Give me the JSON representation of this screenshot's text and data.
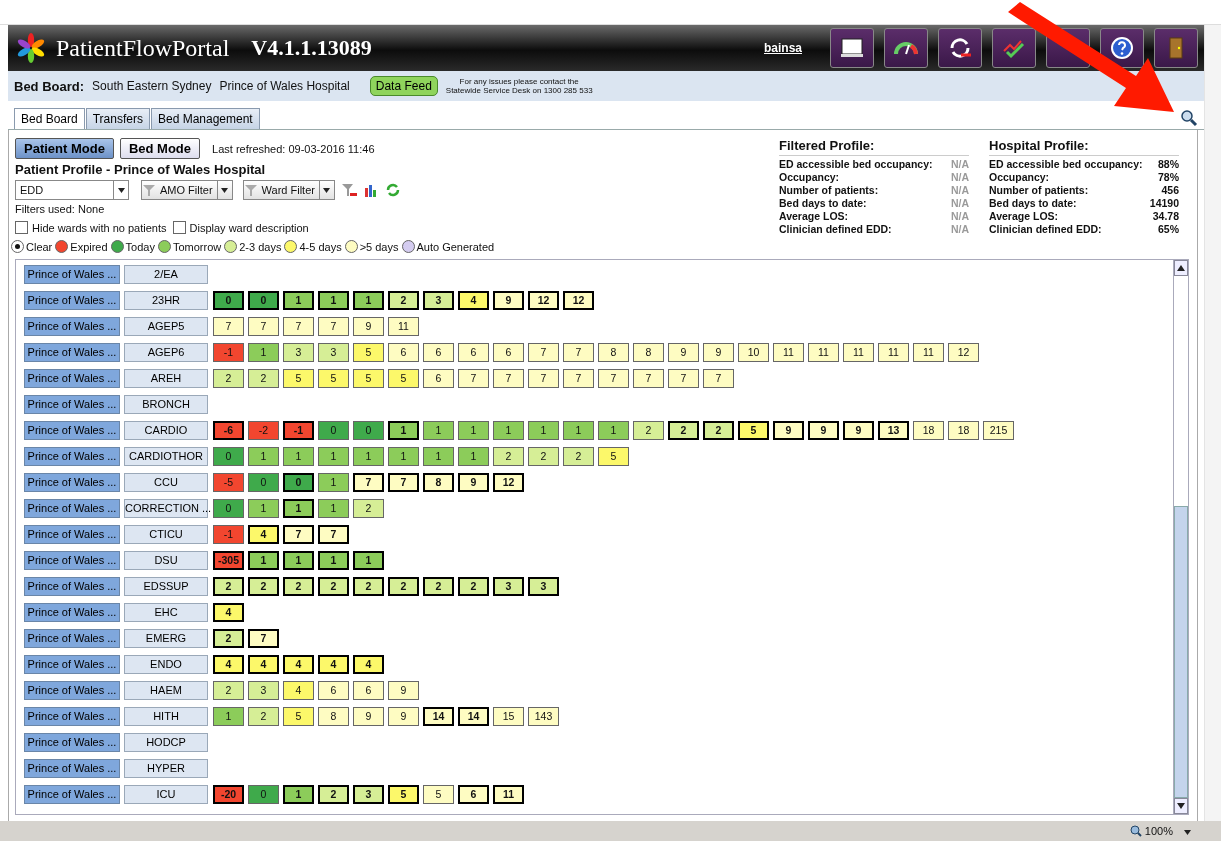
{
  "header": {
    "app_name": "PatientFlowPortal",
    "version": "V4.1.1.13089",
    "user": "bainsa"
  },
  "subheader": {
    "label": "Bed Board:",
    "area": "South Eastern Sydney",
    "hospital": "Prince of Wales Hospital",
    "feed_button": "Data Feed",
    "contact": [
      "For any issues please contact the",
      "Statewide Service Desk on 1300 285 533"
    ]
  },
  "tabs": [
    {
      "label": "Bed Board",
      "selected": true
    },
    {
      "label": "Transfers",
      "selected": false
    },
    {
      "label": "Bed Management",
      "selected": false
    }
  ],
  "modes": [
    {
      "label": "Patient Mode",
      "selected": true
    },
    {
      "label": "Bed Mode",
      "selected": false
    }
  ],
  "last_refreshed": "Last refreshed: 09-03-2016 11:46",
  "profile_title": "Patient Profile - Prince of Wales Hospital",
  "filters": {
    "sort": "EDD",
    "amo": "AMO Filter",
    "ward": "Ward Filter",
    "used": "Filters used: None"
  },
  "options": [
    {
      "label": "Hide wards with no patients",
      "checked": false
    },
    {
      "label": "Display ward description",
      "checked": false
    }
  ],
  "legend": [
    {
      "label": "Clear",
      "color": "#ffffff",
      "selected": true
    },
    {
      "label": "Expired",
      "color": "#f2462f",
      "selected": false
    },
    {
      "label": "Today",
      "color": "#3faa4b",
      "selected": false
    },
    {
      "label": "Tomorrow",
      "color": "#8ccc5a",
      "selected": false
    },
    {
      "label": "2-3 days",
      "color": "#d6ee96",
      "selected": false
    },
    {
      "label": "4-5 days",
      "color": "#fcf86a",
      "selected": false
    },
    {
      "label": ">5 days",
      "color": "#fefcc2",
      "selected": false
    },
    {
      "label": "Auto Generated",
      "color": "#d4ccf0",
      "selected": false
    }
  ],
  "profiles": [
    {
      "title": "Filtered Profile:",
      "muted": true,
      "rows": [
        [
          "ED accessible bed occupancy:",
          "N/A"
        ],
        [
          "Occupancy:",
          "N/A"
        ],
        [
          "Number of patients:",
          "N/A"
        ],
        [
          "Bed days to date:",
          "N/A"
        ],
        [
          "Average LOS:",
          "N/A"
        ],
        [
          "Clinician defined EDD:",
          "N/A"
        ]
      ]
    },
    {
      "title": "Hospital Profile:",
      "muted": false,
      "rows": [
        [
          "ED accessible bed occupancy:",
          "88%"
        ],
        [
          "Occupancy:",
          "78%"
        ],
        [
          "Number of patients:",
          "456"
        ],
        [
          "Bed days to date:",
          "14190"
        ],
        [
          "Average LOS:",
          "34.78"
        ],
        [
          "Clinician defined EDD:",
          "65%"
        ]
      ]
    }
  ],
  "wards": [
    {
      "hospital": "Prince of Wales ...",
      "ward": "2/EA"
    },
    {
      "hospital": "Prince of Wales ...",
      "ward": "23HR",
      "beds": [
        {
          "value": "0",
          "color": "#3faa4b",
          "bold": true
        },
        {
          "value": "0",
          "color": "#3faa4b",
          "bold": true
        },
        {
          "value": "1",
          "color": "#8ccc5a",
          "bold": true
        },
        {
          "value": "1",
          "color": "#8ccc5a",
          "bold": true
        },
        {
          "value": "1",
          "color": "#8ccc5a",
          "bold": true
        },
        {
          "value": "2",
          "color": "#d6ee96",
          "bold": true
        },
        {
          "value": "3",
          "color": "#d6ee96",
          "bold": true
        },
        {
          "value": "4",
          "color": "#fcf86a",
          "bold": true
        },
        {
          "value": "9",
          "color": "#fefcc2",
          "bold": true
        },
        {
          "value": "12",
          "color": "#fefcc2",
          "bold": true
        },
        {
          "value": "12",
          "color": "#fefcc2",
          "bold": true
        }
      ]
    },
    {
      "hospital": "Prince of Wales ...",
      "ward": "AGEP5",
      "beds": [
        {
          "value": "7",
          "color": "#fefcc2",
          "bold": false
        },
        {
          "value": "7",
          "color": "#fefcc2",
          "bold": false
        },
        {
          "value": "7",
          "color": "#fefcc2",
          "bold": false
        },
        {
          "value": "7",
          "color": "#fefcc2",
          "bold": false
        },
        {
          "value": "9",
          "color": "#fefcc2",
          "bold": false
        },
        {
          "value": "11",
          "color": "#fefcc2",
          "bold": false
        }
      ]
    },
    {
      "hospital": "Prince of Wales ...",
      "ward": "AGEP6",
      "beds": [
        {
          "value": "-1",
          "color": "#f2462f",
          "bold": false
        },
        {
          "value": "1",
          "color": "#8ccc5a",
          "bold": false
        },
        {
          "value": "3",
          "color": "#d6ee96",
          "bold": false
        },
        {
          "value": "3",
          "color": "#d6ee96",
          "bold": false
        },
        {
          "value": "5",
          "color": "#fcf86a",
          "bold": false
        },
        {
          "value": "6",
          "color": "#fefcc2",
          "bold": false
        },
        {
          "value": "6",
          "color": "#fefcc2",
          "bold": false
        },
        {
          "value": "6",
          "color": "#fefcc2",
          "bold": false
        },
        {
          "value": "6",
          "color": "#fefcc2",
          "bold": false
        },
        {
          "value": "7",
          "color": "#fefcc2",
          "bold": false
        },
        {
          "value": "7",
          "color": "#fefcc2",
          "bold": false
        },
        {
          "value": "8",
          "color": "#fefcc2",
          "bold": false
        },
        {
          "value": "8",
          "color": "#fefcc2",
          "bold": false
        },
        {
          "value": "9",
          "color": "#fefcc2",
          "bold": false
        },
        {
          "value": "9",
          "color": "#fefcc2",
          "bold": false
        },
        {
          "value": "10",
          "color": "#fefcc2",
          "bold": false
        },
        {
          "value": "11",
          "color": "#fefcc2",
          "bold": false
        },
        {
          "value": "11",
          "color": "#fefcc2",
          "bold": false
        },
        {
          "value": "11",
          "color": "#fefcc2",
          "bold": false
        },
        {
          "value": "11",
          "color": "#fefcc2",
          "bold": false
        },
        {
          "value": "11",
          "color": "#fefcc2",
          "bold": false
        },
        {
          "value": "12",
          "color": "#fefcc2",
          "bold": false
        }
      ]
    },
    {
      "hospital": "Prince of Wales ...",
      "ward": "AREH",
      "beds": [
        {
          "value": "2",
          "color": "#d6ee96",
          "bold": false
        },
        {
          "value": "2",
          "color": "#d6ee96",
          "bold": false
        },
        {
          "value": "5",
          "color": "#fcf86a",
          "bold": false
        },
        {
          "value": "5",
          "color": "#fcf86a",
          "bold": false
        },
        {
          "value": "5",
          "color": "#fcf86a",
          "bold": false
        },
        {
          "value": "5",
          "color": "#fcf86a",
          "bold": false
        },
        {
          "value": "6",
          "color": "#fefcc2",
          "bold": false
        },
        {
          "value": "7",
          "color": "#fefcc2",
          "bold": false
        },
        {
          "value": "7",
          "color": "#fefcc2",
          "bold": false
        },
        {
          "value": "7",
          "color": "#fefcc2",
          "bold": false
        },
        {
          "value": "7",
          "color": "#fefcc2",
          "bold": false
        },
        {
          "value": "7",
          "color": "#fefcc2",
          "bold": false
        },
        {
          "value": "7",
          "color": "#fefcc2",
          "bold": false
        },
        {
          "value": "7",
          "color": "#fefcc2",
          "bold": false
        },
        {
          "value": "7",
          "color": "#fefcc2",
          "bold": false
        }
      ]
    },
    {
      "hospital": "Prince of Wales ...",
      "ward": "BRONCH"
    },
    {
      "hospital": "Prince of Wales ...",
      "ward": "CARDIO",
      "beds": [
        {
          "value": "-6",
          "color": "#f2462f",
          "bold": true
        },
        {
          "value": "-2",
          "color": "#f2462f",
          "bold": false
        },
        {
          "value": "-1",
          "color": "#f2462f",
          "bold": true
        },
        {
          "value": "0",
          "color": "#3faa4b",
          "bold": false
        },
        {
          "value": "0",
          "color": "#3faa4b",
          "bold": false
        },
        {
          "value": "1",
          "color": "#8ccc5a",
          "bold": true
        },
        {
          "value": "1",
          "color": "#8ccc5a",
          "bold": false
        },
        {
          "value": "1",
          "color": "#8ccc5a",
          "bold": false
        },
        {
          "value": "1",
          "color": "#8ccc5a",
          "bold": false
        },
        {
          "value": "1",
          "color": "#8ccc5a",
          "bold": false
        },
        {
          "value": "1",
          "color": "#8ccc5a",
          "bold": false
        },
        {
          "value": "1",
          "color": "#8ccc5a",
          "bold": false
        },
        {
          "value": "2",
          "color": "#d6ee96",
          "bold": false
        },
        {
          "value": "2",
          "color": "#d6ee96",
          "bold": true
        },
        {
          "value": "2",
          "color": "#d6ee96",
          "bold": true
        },
        {
          "value": "5",
          "color": "#fcf86a",
          "bold": true
        },
        {
          "value": "9",
          "color": "#fefcc2",
          "bold": true
        },
        {
          "value": "9",
          "color": "#fefcc2",
          "bold": true
        },
        {
          "value": "9",
          "color": "#fefcc2",
          "bold": true
        },
        {
          "value": "13",
          "color": "#fefcc2",
          "bold": true
        },
        {
          "value": "18",
          "color": "#fefcc2",
          "bold": false
        },
        {
          "value": "18",
          "color": "#fefcc2",
          "bold": false
        },
        {
          "value": "215",
          "color": "#fefcc2",
          "bold": false
        }
      ]
    },
    {
      "hospital": "Prince of Wales ...",
      "ward": "CARDIOTHOR",
      "beds": [
        {
          "value": "0",
          "color": "#3faa4b",
          "bold": false
        },
        {
          "value": "1",
          "color": "#8ccc5a",
          "bold": false
        },
        {
          "value": "1",
          "color": "#8ccc5a",
          "bold": false
        },
        {
          "value": "1",
          "color": "#8ccc5a",
          "bold": false
        },
        {
          "value": "1",
          "color": "#8ccc5a",
          "bold": false
        },
        {
          "value": "1",
          "color": "#8ccc5a",
          "bold": false
        },
        {
          "value": "1",
          "color": "#8ccc5a",
          "bold": false
        },
        {
          "value": "1",
          "color": "#8ccc5a",
          "bold": false
        },
        {
          "value": "2",
          "color": "#d6ee96",
          "bold": false
        },
        {
          "value": "2",
          "color": "#d6ee96",
          "bold": false
        },
        {
          "value": "2",
          "color": "#d6ee96",
          "bold": false
        },
        {
          "value": "5",
          "color": "#fcf86a",
          "bold": false
        }
      ]
    },
    {
      "hospital": "Prince of Wales ...",
      "ward": "CCU",
      "beds": [
        {
          "value": "-5",
          "color": "#f2462f",
          "bold": false
        },
        {
          "value": "0",
          "color": "#3faa4b",
          "bold": false
        },
        {
          "value": "0",
          "color": "#3faa4b",
          "bold": true
        },
        {
          "value": "1",
          "color": "#8ccc5a",
          "bold": false
        },
        {
          "value": "7",
          "color": "#fefcc2",
          "bold": true
        },
        {
          "value": "7",
          "color": "#fefcc2",
          "bold": true
        },
        {
          "value": "8",
          "color": "#fefcc2",
          "bold": true
        },
        {
          "value": "9",
          "color": "#fefcc2",
          "bold": true
        },
        {
          "value": "12",
          "color": "#fefcc2",
          "bold": true
        }
      ]
    },
    {
      "hospital": "Prince of Wales ...",
      "ward": "CORRECTION ...",
      "beds": [
        {
          "value": "0",
          "color": "#3faa4b",
          "bold": false
        },
        {
          "value": "1",
          "color": "#8ccc5a",
          "bold": false
        },
        {
          "value": "1",
          "color": "#8ccc5a",
          "bold": true
        },
        {
          "value": "1",
          "color": "#8ccc5a",
          "bold": false
        },
        {
          "value": "2",
          "color": "#d6ee96",
          "bold": false
        }
      ]
    },
    {
      "hospital": "Prince of Wales ...",
      "ward": "CTICU",
      "beds": [
        {
          "value": "-1",
          "color": "#f2462f",
          "bold": false
        },
        {
          "value": "4",
          "color": "#fcf86a",
          "bold": true
        },
        {
          "value": "7",
          "color": "#fefcc2",
          "bold": true
        },
        {
          "value": "7",
          "color": "#fefcc2",
          "bold": true
        }
      ]
    },
    {
      "hospital": "Prince of Wales ...",
      "ward": "DSU",
      "beds": [
        {
          "value": "-305",
          "color": "#f2462f",
          "bold": true
        },
        {
          "value": "1",
          "color": "#8ccc5a",
          "bold": true
        },
        {
          "value": "1",
          "color": "#8ccc5a",
          "bold": true
        },
        {
          "value": "1",
          "color": "#8ccc5a",
          "bold": true
        },
        {
          "value": "1",
          "color": "#8ccc5a",
          "bold": true
        }
      ]
    },
    {
      "hospital": "Prince of Wales ...",
      "ward": "EDSSUP",
      "beds": [
        {
          "value": "2",
          "color": "#d6ee96",
          "bold": true
        },
        {
          "value": "2",
          "color": "#d6ee96",
          "bold": true
        },
        {
          "value": "2",
          "color": "#d6ee96",
          "bold": true
        },
        {
          "value": "2",
          "color": "#d6ee96",
          "bold": true
        },
        {
          "value": "2",
          "color": "#d6ee96",
          "bold": true
        },
        {
          "value": "2",
          "color": "#d6ee96",
          "bold": true
        },
        {
          "value": "2",
          "color": "#d6ee96",
          "bold": true
        },
        {
          "value": "2",
          "color": "#d6ee96",
          "bold": true
        },
        {
          "value": "3",
          "color": "#d6ee96",
          "bold": true
        },
        {
          "value": "3",
          "color": "#d6ee96",
          "bold": true
        }
      ]
    },
    {
      "hospital": "Prince of Wales ...",
      "ward": "EHC",
      "beds": [
        {
          "value": "4",
          "color": "#fcf86a",
          "bold": true
        }
      ]
    },
    {
      "hospital": "Prince of Wales ...",
      "ward": "EMERG",
      "beds": [
        {
          "value": "2",
          "color": "#d6ee96",
          "bold": true
        },
        {
          "value": "7",
          "color": "#fefcc2",
          "bold": true
        }
      ]
    },
    {
      "hospital": "Prince of Wales ...",
      "ward": "ENDO",
      "beds": [
        {
          "value": "4",
          "color": "#fcf86a",
          "bold": true
        },
        {
          "value": "4",
          "color": "#fcf86a",
          "bold": true
        },
        {
          "value": "4",
          "color": "#fcf86a",
          "bold": true
        },
        {
          "value": "4",
          "color": "#fcf86a",
          "bold": true
        },
        {
          "value": "4",
          "color": "#fcf86a",
          "bold": true
        }
      ]
    },
    {
      "hospital": "Prince of Wales ...",
      "ward": "HAEM",
      "beds": [
        {
          "value": "2",
          "color": "#d6ee96",
          "bold": false
        },
        {
          "value": "3",
          "color": "#d6ee96",
          "bold": false
        },
        {
          "value": "4",
          "color": "#fcf86a",
          "bold": false
        },
        {
          "value": "6",
          "color": "#fefcc2",
          "bold": false
        },
        {
          "value": "6",
          "color": "#fefcc2",
          "bold": false
        },
        {
          "value": "9",
          "color": "#fefcc2",
          "bold": false
        }
      ]
    },
    {
      "hospital": "Prince of Wales ...",
      "ward": "HITH",
      "beds": [
        {
          "value": "1",
          "color": "#8ccc5a",
          "bold": false
        },
        {
          "value": "2",
          "color": "#d6ee96",
          "bold": false
        },
        {
          "value": "5",
          "color": "#fcf86a",
          "bold": false
        },
        {
          "value": "8",
          "color": "#fefcc2",
          "bold": false
        },
        {
          "value": "9",
          "color": "#fefcc2",
          "bold": false
        },
        {
          "value": "9",
          "color": "#fefcc2",
          "bold": false
        },
        {
          "value": "14",
          "color": "#fefcc2",
          "bold": true
        },
        {
          "value": "14",
          "color": "#fefcc2",
          "bold": true
        },
        {
          "value": "15",
          "color": "#fefcc2",
          "bold": false
        },
        {
          "value": "143",
          "color": "#fefcc2",
          "bold": false
        }
      ]
    },
    {
      "hospital": "Prince of Wales ...",
      "ward": "HODCP"
    },
    {
      "hospital": "Prince of Wales ...",
      "ward": "HYPER"
    },
    {
      "hospital": "Prince of Wales ...",
      "ward": "ICU",
      "beds": [
        {
          "value": "-20",
          "color": "#f2462f",
          "bold": true
        },
        {
          "value": "0",
          "color": "#3faa4b",
          "bold": false
        },
        {
          "value": "1",
          "color": "#8ccc5a",
          "bold": true
        },
        {
          "value": "2",
          "color": "#d6ee96",
          "bold": true
        },
        {
          "value": "3",
          "color": "#d6ee96",
          "bold": true
        },
        {
          "value": "5",
          "color": "#fcf86a",
          "bold": true
        },
        {
          "value": "5",
          "color": "#fefcc2",
          "bold": false
        },
        {
          "value": "6",
          "color": "#fefcc2",
          "bold": true
        },
        {
          "value": "11",
          "color": "#fefcc2",
          "bold": true
        }
      ]
    }
  ],
  "status_bar": {
    "zoom": "100%"
  }
}
